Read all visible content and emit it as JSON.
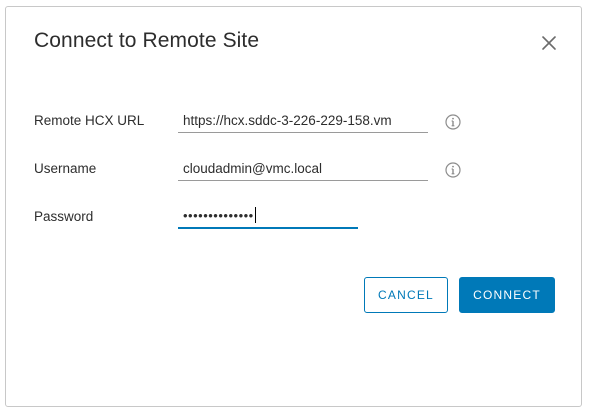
{
  "dialog": {
    "title": "Connect to Remote Site"
  },
  "form": {
    "url_label": "Remote HCX URL",
    "url_value": "https://hcx.sddc-3-226-229-158.vm",
    "username_label": "Username",
    "username_value": "cloudadmin@vmc.local",
    "password_label": "Password",
    "password_value": "••••••••••••••"
  },
  "buttons": {
    "cancel_label": "CANCEL",
    "connect_label": "CONNECT"
  },
  "icons": {
    "close": "close-icon",
    "info": "info-icon"
  },
  "colors": {
    "accent": "#0079b8",
    "text": "#2d2d2d",
    "border": "#c8c8c8",
    "icon_gray": "#8c8c8c"
  }
}
